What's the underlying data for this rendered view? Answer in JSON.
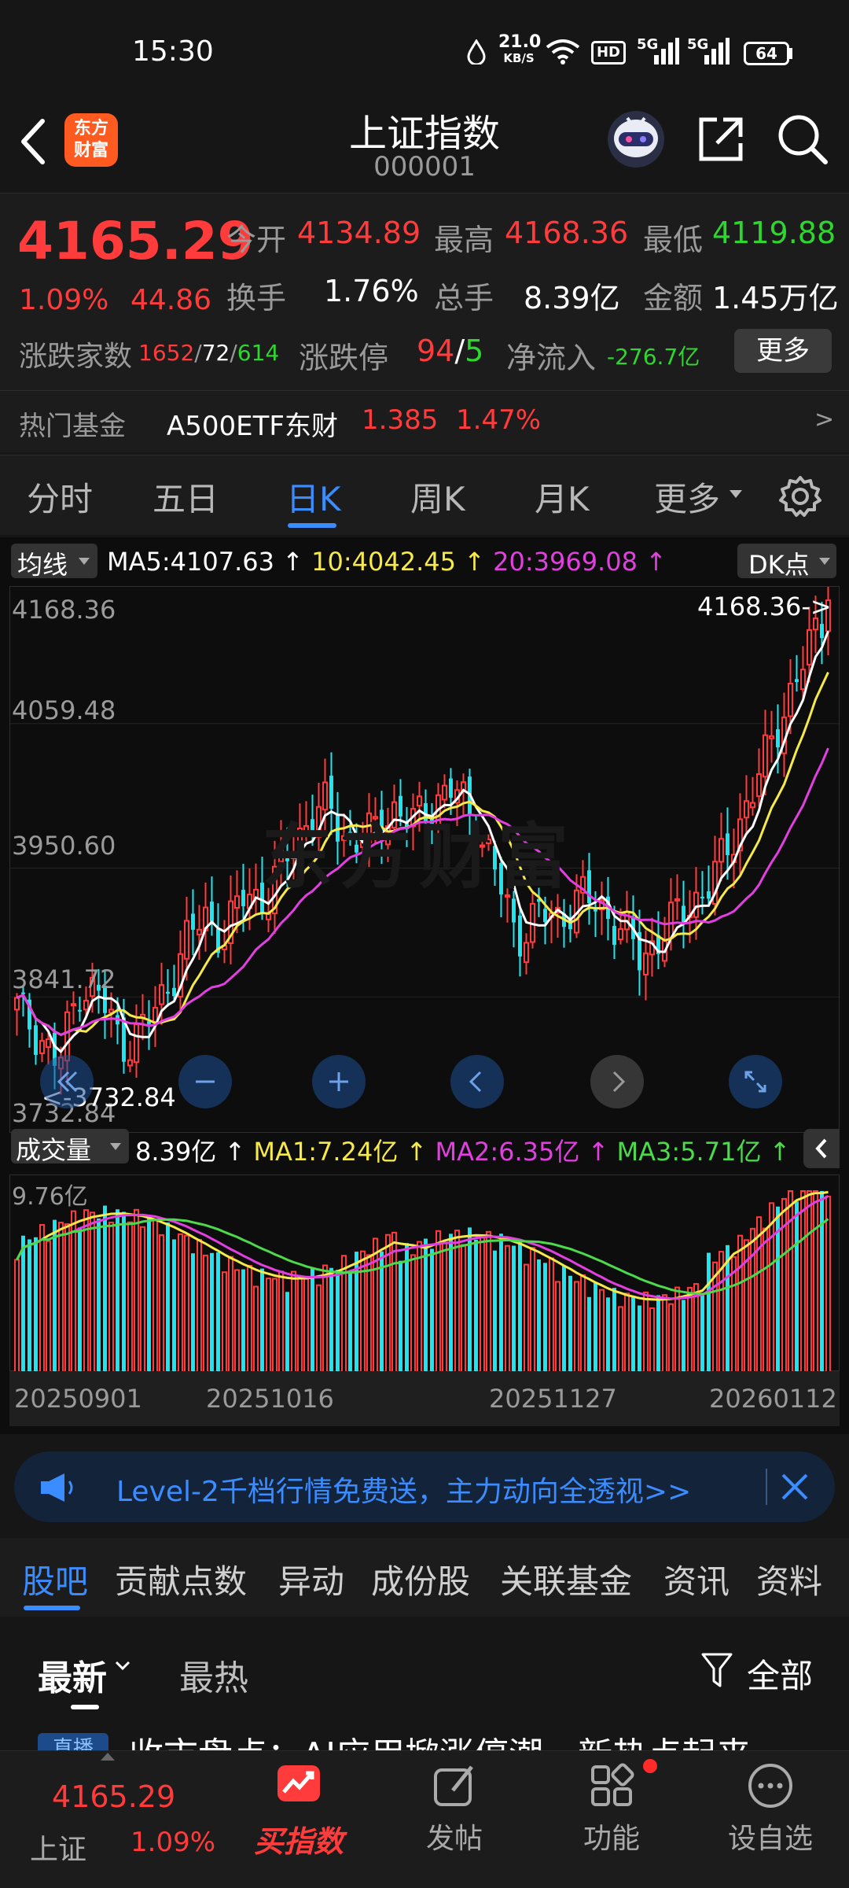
{
  "status_bar": {
    "time": "15:30",
    "net_speed_value": "21.0",
    "net_speed_unit": "KB/S",
    "hd_badge": "HD",
    "signal1": "5G",
    "signal2": "5G",
    "battery": "64"
  },
  "header": {
    "logo_line1": "东方",
    "logo_line2": "财富",
    "title": "上证指数",
    "code": "000001"
  },
  "quote": {
    "price": "4165.29",
    "change_pct": "1.09%",
    "change_amt": "44.86",
    "open_label": "今开",
    "open": "4134.89",
    "high_label": "最高",
    "high": "4168.36",
    "low_label": "最低",
    "low": "4119.88",
    "turnover_label": "换手",
    "turnover": "1.76%",
    "volume_label": "总手",
    "volume": "8.39亿",
    "amount_label": "金额",
    "amount": "1.45万亿",
    "breadth_label": "涨跌家数",
    "up_count": "1652",
    "sep1": "/",
    "flat_count": "72",
    "sep2": "/",
    "down_count": "614",
    "limit_label": "涨跌停",
    "limit_up": "94",
    "limit_sep": "/",
    "limit_down": "5",
    "netflow_label": "净流入",
    "netflow": "-276.7亿",
    "more_btn": "更多"
  },
  "hot_fund": {
    "label": "热门基金",
    "name": "A500ETF东财",
    "price": "1.385",
    "pct": "1.47%",
    "arrow": ">"
  },
  "period_tabs": [
    "分时",
    "五日",
    "日K",
    "周K",
    "月K",
    "更多"
  ],
  "active_tab": 2,
  "kline": {
    "indicator_select": "均线",
    "ma5": "MA5:4107.63",
    "ma10": "10:4042.45",
    "ma20": "20:3969.08",
    "up_arrow": "↑",
    "dk_button": "DK点",
    "y_labels": [
      "4168.36",
      "4059.48",
      "3950.60",
      "3841.72",
      "3732.84"
    ],
    "high_marker": "4168.36->",
    "low_marker": "<-3732.84",
    "watermark": "东方财富"
  },
  "volume": {
    "indicator_select": "成交量",
    "vol": "8.39亿",
    "ma1": "MA1:7.24亿",
    "ma2": "MA2:6.35亿",
    "ma3": "MA3:5.71亿",
    "up_arrow": "↑",
    "max_label": "9.76亿",
    "dates": [
      "20250901",
      "20251016",
      "20251127",
      "20260112"
    ]
  },
  "banner": {
    "text": "Level-2千档行情免费送，主力动向全透视>>"
  },
  "sub_tabs": [
    "股吧",
    "贡献点数",
    "异动",
    "成份股",
    "关联基金",
    "资讯",
    "资料"
  ],
  "feed": {
    "sort_latest": "最新",
    "sort_hot": "最热",
    "filter": "全部",
    "badge": "直播",
    "headline": "收市盘点：AI应用掀涨停潮，新热点起来"
  },
  "bottom_nav": {
    "index_price": "4165.29",
    "index_name": "上证",
    "index_pct": "1.09%",
    "buy": "买指数",
    "post": "发帖",
    "func": "功能",
    "watch": "设自选"
  },
  "colors": {
    "up": "#ff3b3b",
    "down": "#22e4ee",
    "ma5": "#ffffff",
    "ma10": "#f6e94a",
    "ma20": "#e23fe0",
    "accent_blue": "#3a8cff",
    "brand_orange": "#ff5a1f"
  },
  "icons": [
    "back-arrow-icon",
    "robot-avatar-icon",
    "share-icon",
    "search-icon",
    "settings-gear-icon",
    "megaphone-icon",
    "close-icon",
    "filter-icon",
    "buy-index-icon",
    "post-edit-icon",
    "function-grid-icon",
    "add-watch-icon"
  ]
}
